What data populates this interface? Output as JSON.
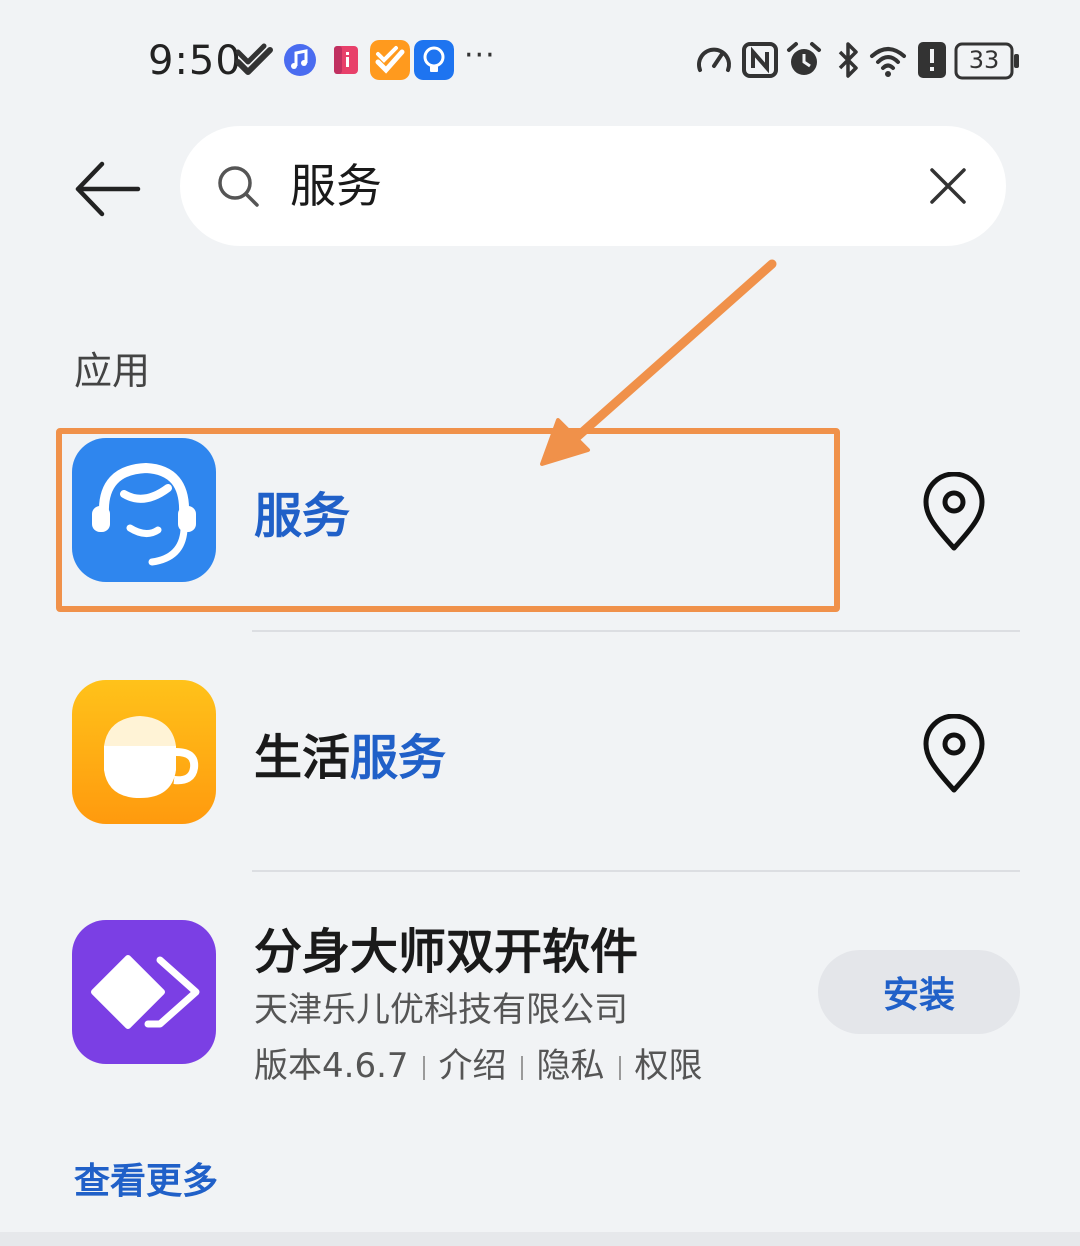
{
  "status_bar": {
    "time": "9:50",
    "battery": "33",
    "notification_icons": [
      "music-app-icon",
      "book-app-icon",
      "orange-app-icon",
      "tips-app-icon"
    ],
    "system_icons": [
      "speedometer-icon",
      "nfc-icon",
      "alarm-icon",
      "bluetooth-icon",
      "wifi-icon",
      "alert-icon",
      "battery-icon"
    ]
  },
  "search": {
    "query": "服务"
  },
  "section": {
    "title": "应用"
  },
  "results": [
    {
      "name_plain": "",
      "name_highlight": "服务",
      "icon": "headset-service-icon",
      "action": "location-pin-icon"
    },
    {
      "name_plain": "生活",
      "name_highlight": "服务",
      "icon": "coffee-cup-icon",
      "action": "location-pin-icon"
    },
    {
      "name_plain": "分身大师双开软件",
      "developer": "天津乐儿优科技有限公司",
      "version": "版本4.6.7",
      "links": [
        "介绍",
        "隐私",
        "权限"
      ],
      "install_label": "安装",
      "icon": "dual-diamond-icon"
    }
  ],
  "see_more": "查看更多",
  "colors": {
    "accent": "#2060c8",
    "annotation": "#f0914a",
    "background": "#f1f3f5"
  }
}
